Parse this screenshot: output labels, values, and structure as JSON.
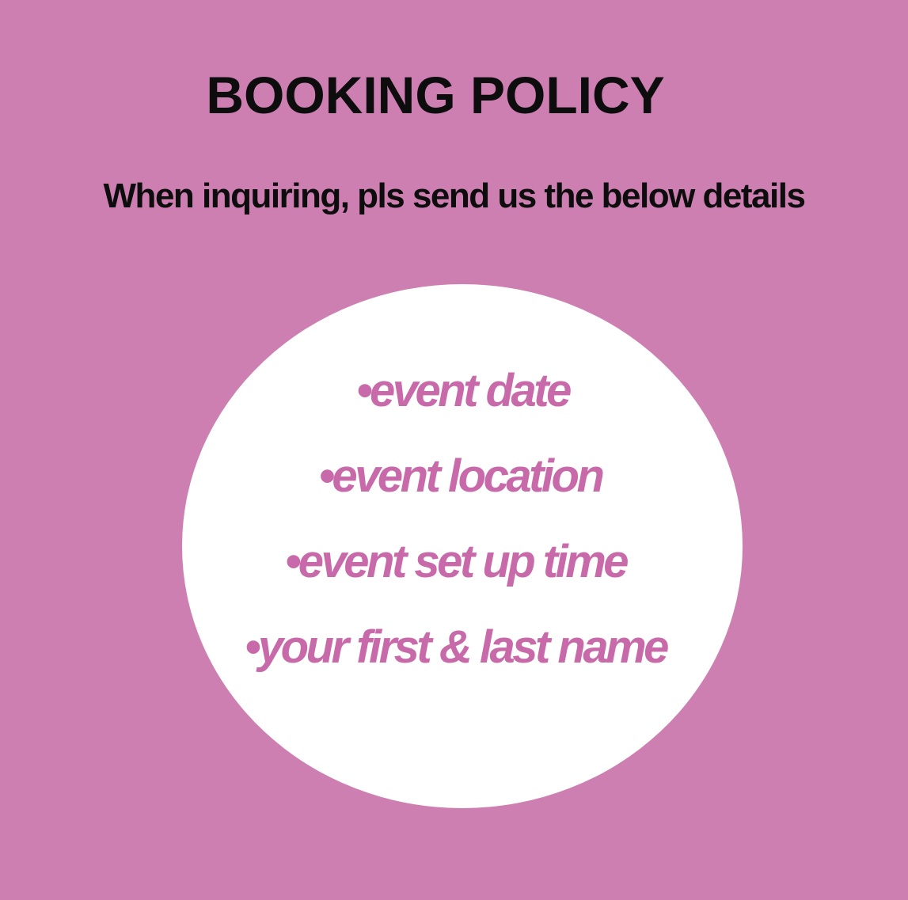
{
  "title": "BOOKING POLICY",
  "subtitle": "When inquiring, pls send us the below details",
  "details": [
    "•event date",
    "•event location",
    "•event set up time",
    "•your first & last name"
  ],
  "colors": {
    "background": "#ce7fb1",
    "circle": "#ffffff",
    "heading_text": "#0d0d0d",
    "list_text": "#c86aaa"
  }
}
